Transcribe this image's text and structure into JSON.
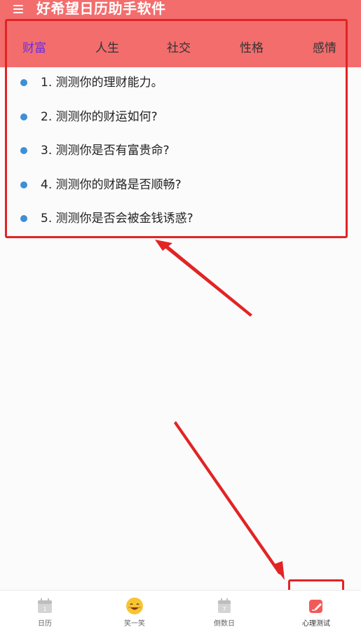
{
  "header": {
    "app_title": "好希望日历助手软件",
    "background_color": "#f36d6d",
    "menu_icon": "hamburger-menu-icon"
  },
  "tabs": [
    {
      "label": "财富",
      "active": true
    },
    {
      "label": "人生",
      "active": false
    },
    {
      "label": "社交",
      "active": false
    },
    {
      "label": "性格",
      "active": false
    },
    {
      "label": "感情",
      "active": false
    }
  ],
  "active_tab_color": "#6a2de0",
  "list": {
    "bullet_color": "#3d8fd6",
    "items": [
      "1. 测测你的理财能力。",
      "2. 测测你的财运如何?",
      "3. 测测你是否有富贵命?",
      "4. 测测你的财路是否顺畅?",
      "5. 测测你是否会被金钱诱惑?"
    ]
  },
  "annotation_color": "#e22424",
  "bottom_nav": [
    {
      "label": "日历",
      "icon": "calendar-icon"
    },
    {
      "label": "笑一笑",
      "icon": "smiley-face-icon"
    },
    {
      "label": "倒数日",
      "icon": "countdown-calendar-icon"
    },
    {
      "label": "心理测试",
      "icon": "edit-note-icon",
      "active": true
    }
  ]
}
